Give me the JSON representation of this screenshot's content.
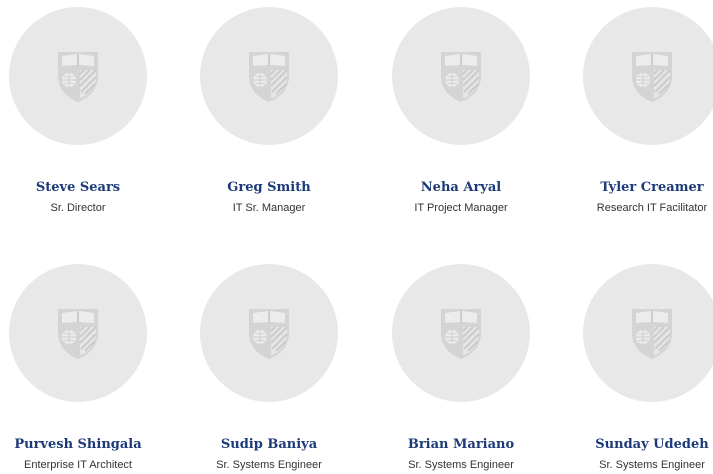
{
  "team": {
    "members": [
      {
        "name": "Steve Sears",
        "title": "Sr. Director"
      },
      {
        "name": "Greg Smith",
        "title": "IT Sr. Manager"
      },
      {
        "name": "Neha Aryal",
        "title": "IT Project Manager"
      },
      {
        "name": "Tyler Creamer",
        "title": "Research IT Facilitator"
      },
      {
        "name": "Purvesh Shingala",
        "title": "Enterprise IT Architect"
      },
      {
        "name": "Sudip Baniya",
        "title": "Sr. Systems Engineer"
      },
      {
        "name": "Brian Mariano",
        "title": "Sr. Systems Engineer"
      },
      {
        "name": "Sunday Udedeh",
        "title": "Sr. Systems Engineer"
      }
    ]
  },
  "colors": {
    "name": "#1c3a78",
    "avatar_bg": "#e8e8e8",
    "shield": "#d2d2d2"
  },
  "icons": {
    "placeholder": "university-shield-icon"
  }
}
